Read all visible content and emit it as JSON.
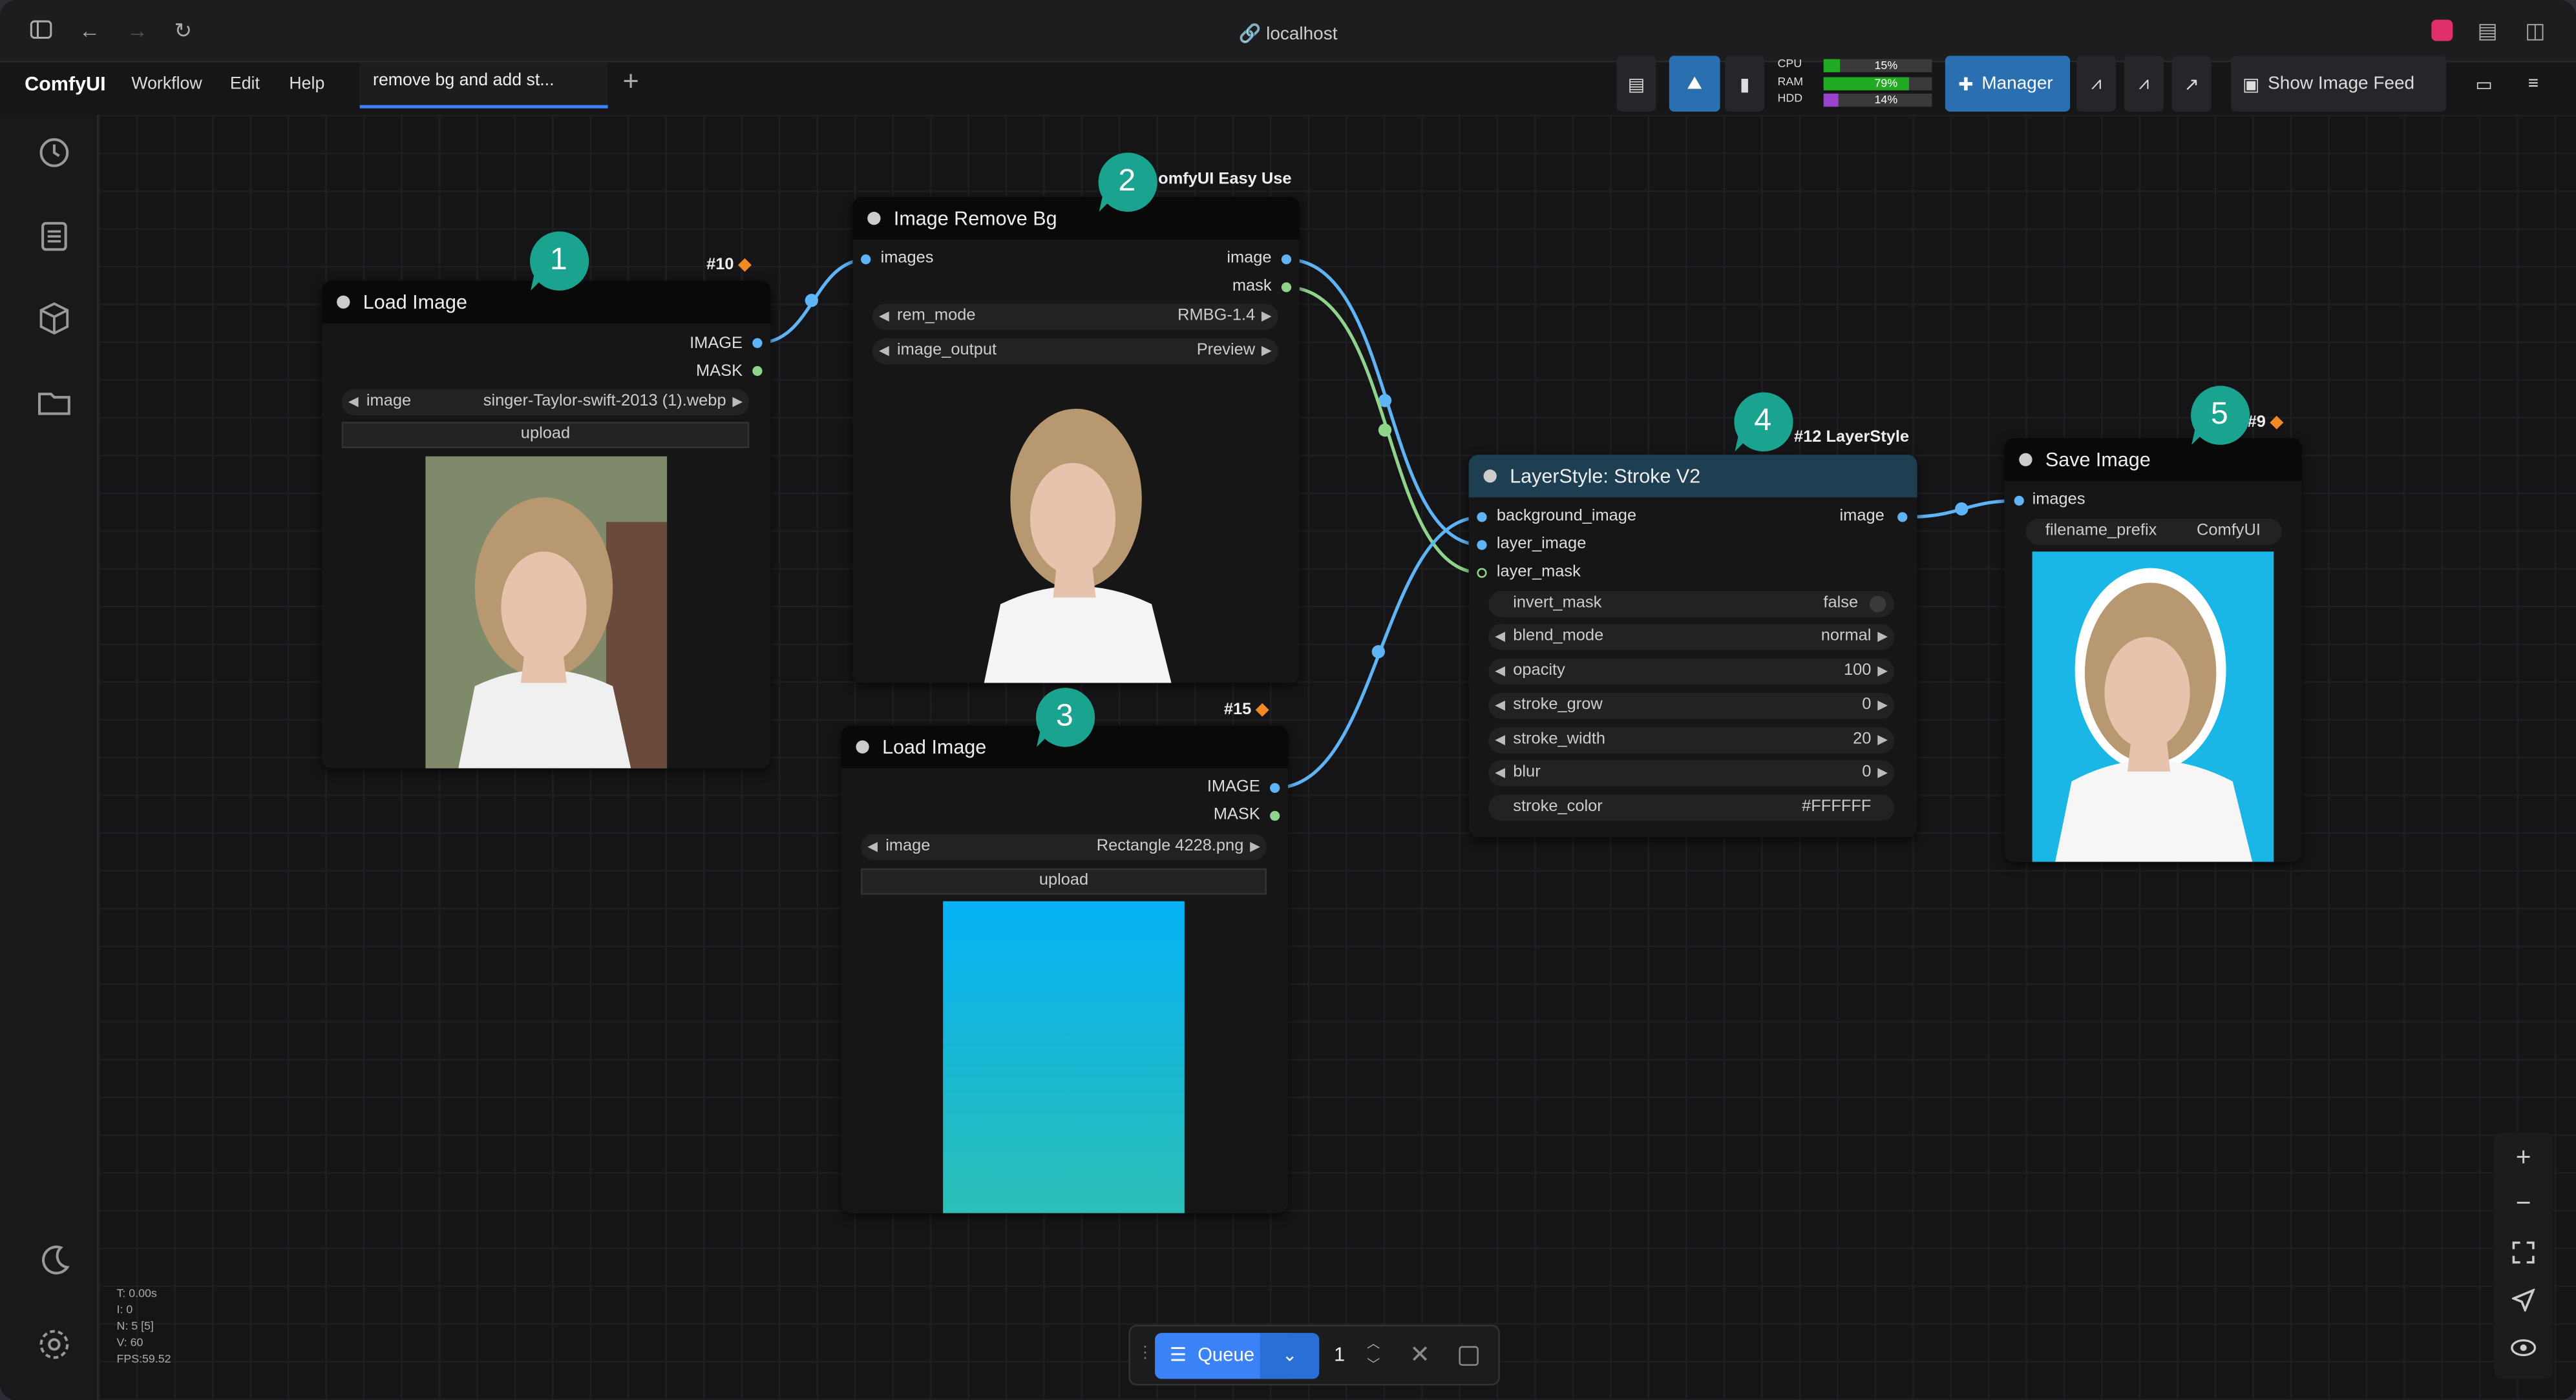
{
  "url": "localhost",
  "app": {
    "name": "ComfyUI",
    "menus": [
      "Workflow",
      "Edit",
      "Help"
    ]
  },
  "tab": {
    "title": "remove bg and add st...",
    "add_label": "+"
  },
  "toolbar": {
    "manager_label": "Manager",
    "image_feed_label": "Show Image Feed"
  },
  "monitor": [
    {
      "label": "CPU",
      "pct": 15,
      "pct_text": "15%",
      "color": "#22aa22"
    },
    {
      "label": "RAM",
      "pct": 79,
      "pct_text": "79%",
      "color": "#22aa22"
    },
    {
      "label": "HDD",
      "pct": 14,
      "pct_text": "14%",
      "color": "#9944cc"
    }
  ],
  "nodes": {
    "load1": {
      "title": "Load Image",
      "tag": "#10",
      "badge": "1",
      "out1": "IMAGE",
      "out2": "MASK",
      "w_image_label": "image",
      "w_image_value": "singer-Taylor-swift-2013 (1).webp",
      "upload": "upload"
    },
    "removebg": {
      "title": "Image Remove Bg",
      "tag": "omfyUI Easy Use",
      "badge": "2",
      "in1": "images",
      "out1": "image",
      "out2": "mask",
      "w1_label": "rem_mode",
      "w1_value": "RMBG-1.4",
      "w2_label": "image_output",
      "w2_value": "Preview"
    },
    "load2": {
      "title": "Load Image",
      "tag": "#15",
      "badge": "3",
      "out1": "IMAGE",
      "out2": "MASK",
      "w_image_label": "image",
      "w_image_value": "Rectangle 4228.png",
      "upload": "upload"
    },
    "stroke": {
      "title": "LayerStyle: Stroke V2",
      "tag": "#12 LayerStyle",
      "badge": "4",
      "in1": "background_image",
      "in2": "layer_image",
      "in3": "layer_mask",
      "out1": "image",
      "widgets": [
        {
          "label": "invert_mask",
          "value": "false"
        },
        {
          "label": "blend_mode",
          "value": "normal"
        },
        {
          "label": "opacity",
          "value": "100"
        },
        {
          "label": "stroke_grow",
          "value": "0"
        },
        {
          "label": "stroke_width",
          "value": "20"
        },
        {
          "label": "blur",
          "value": "0"
        },
        {
          "label": "stroke_color",
          "value": "#FFFFFF"
        }
      ]
    },
    "save": {
      "title": "Save Image",
      "tag": "#9",
      "badge": "5",
      "in1": "images",
      "w_label": "filename_prefix",
      "w_value": "ComfyUI"
    }
  },
  "stats": [
    "T: 0.00s",
    "I: 0",
    "N: 5 [5]",
    "V: 60",
    "FPS:59.52"
  ],
  "queue": {
    "label": "Queue",
    "count": "1"
  },
  "colors": {
    "badge": "#1aa38f",
    "accent": "#3b82f6",
    "stroke_header": "#1e3e52"
  }
}
